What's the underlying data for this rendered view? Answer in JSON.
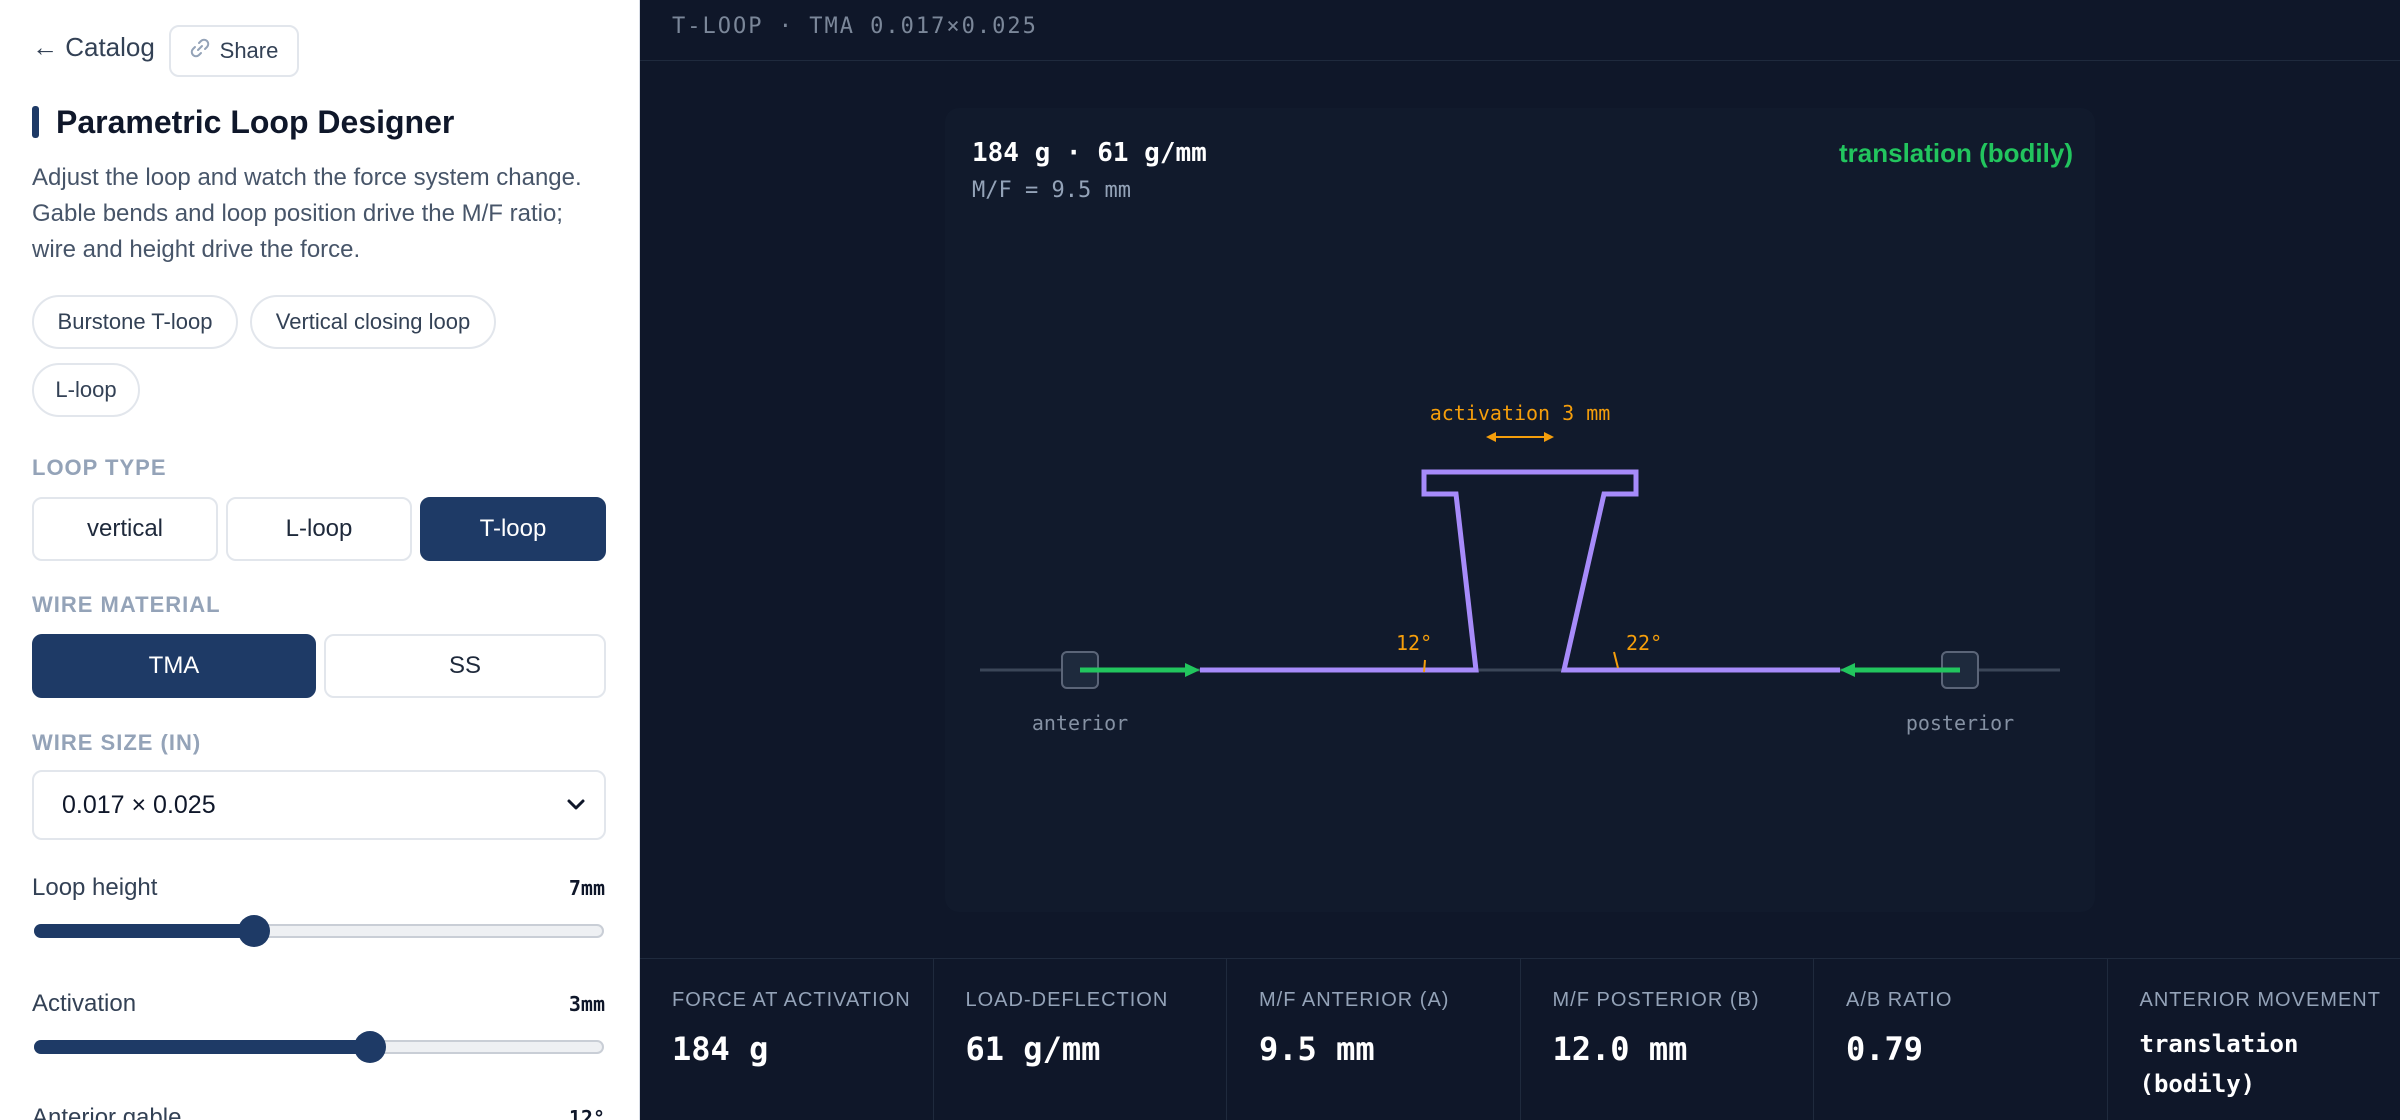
{
  "sidebar": {
    "back_label": "← Catalog",
    "share_label": "Share",
    "title": "Parametric Loop Designer",
    "description": "Adjust the loop and watch the force system change. Gable bends and loop position drive the M/F ratio; wire and height drive the force.",
    "presets": [
      "Burstone T-loop",
      "Vertical closing loop",
      "L-loop"
    ],
    "loop_type": {
      "label": "LOOP TYPE",
      "options": [
        "vertical",
        "L-loop",
        "T-loop"
      ],
      "selected": "T-loop"
    },
    "wire_material": {
      "label": "WIRE MATERIAL",
      "options": [
        "TMA",
        "SS"
      ],
      "selected": "TMA"
    },
    "wire_size": {
      "label": "WIRE SIZE (IN)",
      "value": "0.017 × 0.025"
    },
    "sliders": [
      {
        "label": "Loop height",
        "value_text": "7mm",
        "fraction": 0.385
      },
      {
        "label": "Activation",
        "value_text": "3mm",
        "fraction": 0.59
      },
      {
        "label": "Anterior gable",
        "value_text": "12°"
      }
    ]
  },
  "main": {
    "header": "T-LOOP · TMA 0.017×0.025",
    "readout_main": "184 g · 61 g/mm",
    "readout_sub": "M/F = 9.5 mm",
    "movement_type": "translation (bodily)",
    "diagram": {
      "activation_label": "activation 3 mm",
      "anterior_angle": "12°",
      "posterior_angle": "22°",
      "anterior_label": "anterior",
      "posterior_label": "posterior"
    },
    "stats": [
      {
        "label": "FORCE AT ACTIVATION",
        "value": "184 g"
      },
      {
        "label": "LOAD-DEFLECTION",
        "value": "61 g/mm"
      },
      {
        "label": "M/F ANTERIOR (A)",
        "value": "9.5 mm"
      },
      {
        "label": "M/F POSTERIOR (B)",
        "value": "12.0 mm"
      },
      {
        "label": "A/B RATIO",
        "value": "0.79"
      },
      {
        "label": "ANTERIOR MOVEMENT",
        "value": "translation (bodily)"
      }
    ]
  },
  "colors": {
    "accent": "#1e3a66",
    "loop_wire": "#a78bfa",
    "force_arrow": "#22c55e",
    "annotation": "#f59e0b",
    "background": "#0f1729"
  },
  "icons": {
    "share": "link-icon",
    "select": "chevron-down-icon"
  }
}
